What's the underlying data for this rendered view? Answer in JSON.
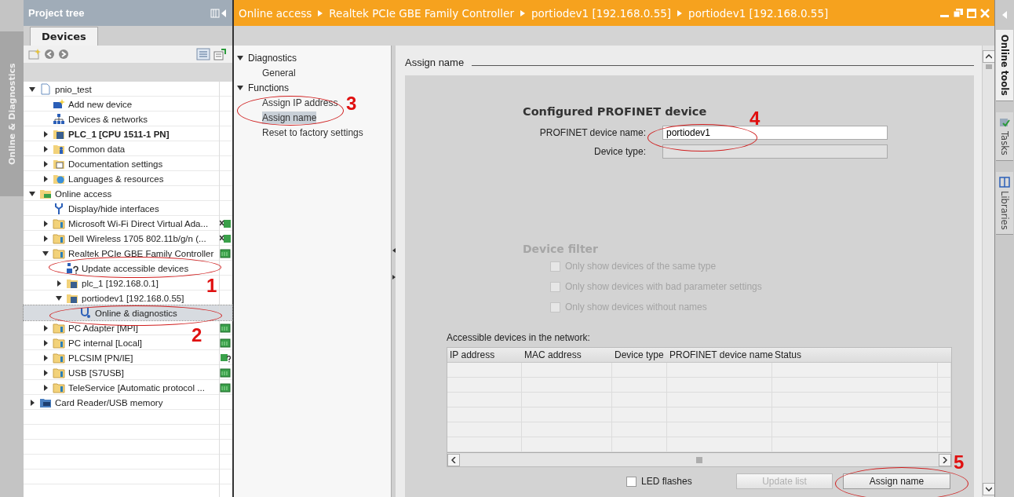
{
  "side_strip": {
    "label": "Online & Diagnostics"
  },
  "project_tree": {
    "title": "Project tree",
    "tabs": [
      {
        "label": "Devices",
        "selected": true
      }
    ],
    "items": [
      {
        "label": "pnio_test",
        "kind": "project",
        "expanded": true,
        "selected": false,
        "children": [
          {
            "label": "Add new device",
            "kind": "add-device",
            "selected": false
          },
          {
            "label": "Devices & networks",
            "kind": "network",
            "selected": false
          },
          {
            "label": "PLC_1 [CPU 1511-1 PN]",
            "kind": "plc",
            "expanded": false,
            "bold": true,
            "selected": false
          },
          {
            "label": "Common data",
            "kind": "common",
            "expanded": false,
            "selected": false
          },
          {
            "label": "Documentation settings",
            "kind": "docs",
            "expanded": false,
            "selected": false
          },
          {
            "label": "Languages & resources",
            "kind": "globe",
            "expanded": false,
            "selected": false
          }
        ]
      },
      {
        "label": "Online access",
        "kind": "online",
        "expanded": true,
        "selected": false,
        "children": [
          {
            "label": "Display/hide interfaces",
            "kind": "wrench",
            "selected": false
          },
          {
            "label": "Microsoft Wi-Fi Direct Virtual Ada...",
            "kind": "folder",
            "expanded": false,
            "badge": {
              "kind": "disconnected"
            },
            "selected": false
          },
          {
            "label": "Dell Wireless 1705 802.11b/g/n (...",
            "kind": "folder",
            "expanded": false,
            "badge": {
              "kind": "disconnected"
            },
            "selected": false
          },
          {
            "label": "Realtek PCIe GBE Family Controller",
            "kind": "folder",
            "expanded": true,
            "badge": {
              "kind": "connected"
            },
            "selected": false,
            "children": [
              {
                "label": "Update accessible devices",
                "kind": "update",
                "selected": false
              },
              {
                "label": "plc_1 [192.168.0.1]",
                "kind": "device",
                "expanded": false,
                "selected": false
              },
              {
                "label": "portiodev1 [192.168.0.55]",
                "kind": "device",
                "expanded": true,
                "selected": false,
                "children": [
                  {
                    "label": "Online & diagnostics",
                    "kind": "diagnostics",
                    "selected": true
                  }
                ]
              }
            ]
          },
          {
            "label": "PC Adapter [MPI]",
            "kind": "folder",
            "expanded": false,
            "badge": {
              "kind": "connected"
            },
            "selected": false
          },
          {
            "label": "PC internal [Local]",
            "kind": "folder",
            "expanded": false,
            "badge": {
              "kind": "connected"
            },
            "selected": false
          },
          {
            "label": "PLCSIM [PN/IE]",
            "kind": "folder",
            "expanded": false,
            "badge": {
              "kind": "unknown"
            },
            "selected": false
          },
          {
            "label": "USB [S7USB]",
            "kind": "folder",
            "expanded": false,
            "badge": {
              "kind": "connected"
            },
            "selected": false
          },
          {
            "label": "TeleService [Automatic protocol ...",
            "kind": "folder",
            "expanded": false,
            "badge": {
              "kind": "connected"
            },
            "selected": false
          }
        ]
      },
      {
        "label": "Card Reader/USB memory",
        "kind": "card",
        "expanded": false,
        "selected": false
      }
    ]
  },
  "editor": {
    "breadcrumb": [
      "Online access",
      "Realtek PCIe GBE Family Controller",
      "portiodev1 [192.168.0.55]",
      "portiodev1 [192.168.0.55]"
    ],
    "nav": [
      {
        "label": "Diagnostics",
        "expanded": true,
        "children": [
          {
            "label": "General",
            "selected": false
          }
        ]
      },
      {
        "label": "Functions",
        "expanded": true,
        "children": [
          {
            "label": "Assign IP address",
            "selected": false
          },
          {
            "label": "Assign name",
            "selected": true
          },
          {
            "label": "Reset to factory settings",
            "selected": false
          }
        ]
      }
    ],
    "section_title": "Assign name",
    "configured": {
      "title": "Configured PROFINET device",
      "fields": [
        {
          "label": "PROFINET device name:",
          "value": "portiodev1",
          "readonly": false
        },
        {
          "label": "Device type:",
          "readonly": true
        }
      ]
    },
    "filter": {
      "title": "Device filter",
      "disabled": true,
      "options": [
        {
          "label": "Only show devices of the same type",
          "checked": false
        },
        {
          "label": "Only show devices with bad parameter settings",
          "checked": false
        },
        {
          "label": "Only show devices without names",
          "checked": false
        }
      ]
    },
    "table": {
      "caption": "Accessible devices in the network:",
      "columns": [
        "IP address",
        "MAC address",
        "Device type",
        "PROFINET device name",
        "Status"
      ]
    },
    "led": {
      "label": "LED flashes",
      "checked": false
    },
    "buttons": [
      {
        "label": "Update list",
        "disabled": true
      },
      {
        "label": "Assign name",
        "disabled": false
      }
    ]
  },
  "right_tabs": [
    {
      "label": "Online tools",
      "selected": true,
      "kind": "plain"
    },
    {
      "label": "Tasks",
      "selected": false,
      "kind": "tasks"
    },
    {
      "label": "Libraries",
      "selected": false,
      "kind": "libraries"
    }
  ],
  "annotations": [
    {
      "label": "1"
    },
    {
      "label": "2"
    },
    {
      "label": "3"
    },
    {
      "label": "4"
    },
    {
      "label": "5"
    }
  ]
}
